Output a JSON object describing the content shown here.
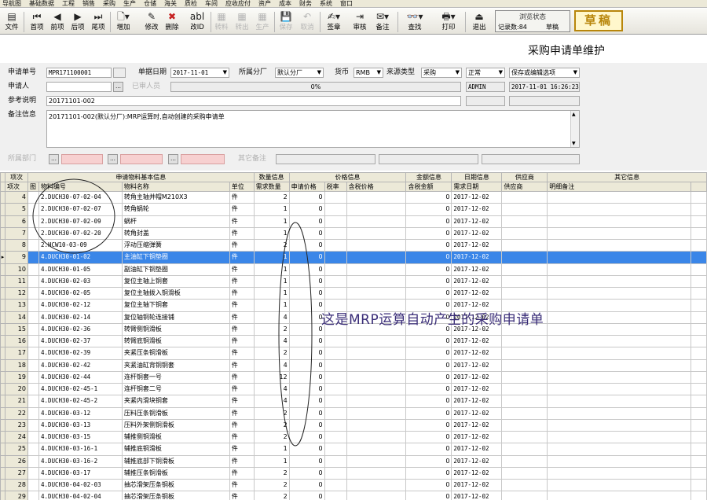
{
  "menu": [
    "导航图",
    "基础数据",
    "工程",
    "销售",
    "采购",
    "生产",
    "仓储",
    "海关",
    "质检",
    "车间",
    "应收应付",
    "资产",
    "成本",
    "财务",
    "系统",
    "窗口"
  ],
  "toolbar": {
    "file": "文件",
    "first": "首项",
    "prev": "前项",
    "next": "后项",
    "last": "尾项",
    "add": "增加",
    "edit": "修改",
    "delete": "删除",
    "change_code": "改ID",
    "batch": "转料",
    "import": "转出",
    "produce": "生产",
    "save": "保存",
    "cancel": "取消",
    "sign": "签章",
    "review": "审核",
    "remark": "备注",
    "find": "查找",
    "print": "打印",
    "exit": "退出"
  },
  "status": {
    "label": "浏览状态",
    "record_count": "记录数:84",
    "state": "草稿"
  },
  "stamp": "草稿",
  "page_title": "采购申请单维护",
  "form": {
    "req_no_label": "申请单号",
    "req_no": "MPR171100001",
    "req_date_label": "单据日期",
    "req_date": "2017-11-01",
    "factory_label": "所属分厂",
    "factory": "默认分厂",
    "currency_label": "货币",
    "currency": "RMB",
    "source_type_label": "来源类型",
    "source_type": "采购",
    "priority": "正常",
    "save_mode": "保存或编辑选项",
    "applicant_label": "申请人",
    "approval_label": "已审人员",
    "progress": "0%",
    "user": "ADMIN",
    "datetime": "2017-11-01 16:26:23",
    "ref_label": "参考说明",
    "ref": "20171101-002",
    "remark_label": "备注信息",
    "remark": "20171101-002(默认分厂):MRP运算时,自动创建的采购申请单",
    "dept_label": "所属部门",
    "other_label": "其它备注"
  },
  "grid": {
    "group_headers": [
      "项次",
      "申请物料基本信息",
      "数量信息",
      "价格信息",
      "金额信息",
      "日期信息",
      "供应商",
      "其它信息"
    ],
    "col_headers": [
      "项次",
      "图",
      "物料编号",
      "物料名称",
      "单位",
      "需求数量",
      "申请价格",
      "税率",
      "含税价格",
      "含税金额",
      "需求日期",
      "供应商",
      "明细备注"
    ],
    "rows": [
      {
        "no": "4",
        "code": "2.DUCH30-07-02-04",
        "name": "转角主轴并帽M210X3",
        "unit": "件",
        "qty": "2",
        "price": "0",
        "amount": "0",
        "date": "2017-12-02"
      },
      {
        "no": "5",
        "code": "2.DUCH30-07-02-07",
        "name": "转角蜗轮",
        "unit": "件",
        "qty": "1",
        "price": "0",
        "amount": "0",
        "date": "2017-12-02"
      },
      {
        "no": "6",
        "code": "2.DUCH30-07-02-09",
        "name": "蜗杆",
        "unit": "件",
        "qty": "1",
        "price": "0",
        "amount": "0",
        "date": "2017-12-02"
      },
      {
        "no": "7",
        "code": "2.DUCH30-07-02-20",
        "name": "转角封盖",
        "unit": "件",
        "qty": "1",
        "price": "0",
        "amount": "0",
        "date": "2017-12-02"
      },
      {
        "no": "8",
        "code": "2.HCW10-03-09",
        "name": "浮动压缩弹簧",
        "unit": "件",
        "qty": "2",
        "price": "0",
        "amount": "0",
        "date": "2017-12-02"
      },
      {
        "no": "9",
        "code": "4.DUCH30-01-02",
        "name": "主油缸下铜垫圈",
        "unit": "件",
        "qty": "1",
        "price": "0",
        "amount": "0",
        "date": "2017-12-02"
      },
      {
        "no": "10",
        "code": "4.DUCH30-01-05",
        "name": "副油缸下铜垫圈",
        "unit": "件",
        "qty": "1",
        "price": "0",
        "amount": "0",
        "date": "2017-12-02"
      },
      {
        "no": "11",
        "code": "4.DUCH30-02-03",
        "name": "复位主轴上铜套",
        "unit": "件",
        "qty": "1",
        "price": "0",
        "amount": "0",
        "date": "2017-12-02"
      },
      {
        "no": "12",
        "code": "4.DUCH30-02-05",
        "name": "复位主轴拨入铜滑板",
        "unit": "件",
        "qty": "1",
        "price": "0",
        "amount": "0",
        "date": "2017-12-02"
      },
      {
        "no": "13",
        "code": "4.DUCH30-02-12",
        "name": "复位主轴下铜套",
        "unit": "件",
        "qty": "1",
        "price": "0",
        "amount": "0",
        "date": "2017-12-02"
      },
      {
        "no": "14",
        "code": "4.DUCH30-02-14",
        "name": "复位轴铜轮连接铺",
        "unit": "件",
        "qty": "4",
        "price": "0",
        "amount": "0",
        "date": "2017-12-02"
      },
      {
        "no": "15",
        "code": "4.DUCH30-02-36",
        "name": "转臂侧铜滑板",
        "unit": "件",
        "qty": "2",
        "price": "0",
        "amount": "0",
        "date": "2017-12-02"
      },
      {
        "no": "16",
        "code": "4.DUCH30-02-37",
        "name": "转臂底铜滑板",
        "unit": "件",
        "qty": "4",
        "price": "0",
        "amount": "0",
        "date": "2017-12-02"
      },
      {
        "no": "17",
        "code": "4.DUCH30-02-39",
        "name": "夹紧压条铜滑板",
        "unit": "件",
        "qty": "2",
        "price": "0",
        "amount": "0",
        "date": "2017-12-02"
      },
      {
        "no": "18",
        "code": "4.DUCH30-02-42",
        "name": "夹紧油缸背铜铜套",
        "unit": "件",
        "qty": "4",
        "price": "0",
        "amount": "0",
        "date": "2017-12-02"
      },
      {
        "no": "19",
        "code": "4.DUCH30-02-44",
        "name": "连杆铜套一号",
        "unit": "件",
        "qty": "12",
        "price": "0",
        "amount": "0",
        "date": "2017-12-02"
      },
      {
        "no": "20",
        "code": "4.DUCH30-02-45-1",
        "name": "连杆铜套二号",
        "unit": "件",
        "qty": "4",
        "price": "0",
        "amount": "0",
        "date": "2017-12-02"
      },
      {
        "no": "21",
        "code": "4.DUCH30-02-45-2",
        "name": "夹紧内滑块铜套",
        "unit": "件",
        "qty": "4",
        "price": "0",
        "amount": "0",
        "date": "2017-12-02"
      },
      {
        "no": "22",
        "code": "4.DUCH30-03-12",
        "name": "压料压条铜滑板",
        "unit": "件",
        "qty": "2",
        "price": "0",
        "amount": "0",
        "date": "2017-12-02"
      },
      {
        "no": "23",
        "code": "4.DUCH30-03-13",
        "name": "压料外架侧铜滑板",
        "unit": "件",
        "qty": "2",
        "price": "0",
        "amount": "0",
        "date": "2017-12-02"
      },
      {
        "no": "24",
        "code": "4.DUCH30-03-15",
        "name": "辅推侧铜滑板",
        "unit": "件",
        "qty": "2",
        "price": "0",
        "amount": "0",
        "date": "2017-12-02"
      },
      {
        "no": "25",
        "code": "4.DUCH30-03-16-1",
        "name": "辅推底铜滑板",
        "unit": "件",
        "qty": "1",
        "price": "0",
        "amount": "0",
        "date": "2017-12-02"
      },
      {
        "no": "26",
        "code": "4.DUCH30-03-16-2",
        "name": "辅推底部下铜滑板",
        "unit": "件",
        "qty": "1",
        "price": "0",
        "amount": "0",
        "date": "2017-12-02"
      },
      {
        "no": "27",
        "code": "4.DUCH30-03-17",
        "name": "辅推压条铜滑板",
        "unit": "件",
        "qty": "2",
        "price": "0",
        "amount": "0",
        "date": "2017-12-02"
      },
      {
        "no": "28",
        "code": "4.DUCH30-04-02-03",
        "name": "抽芯滑架压条铜板",
        "unit": "件",
        "qty": "2",
        "price": "0",
        "amount": "0",
        "date": "2017-12-02"
      },
      {
        "no": "29",
        "code": "4.DUCH30-04-02-04",
        "name": "抽芯滑架压条铜板",
        "unit": "件",
        "qty": "2",
        "price": "0",
        "amount": "0",
        "date": "2017-12-02"
      }
    ],
    "selected_index": 5
  },
  "annotation": "这是MRP运算自动产生的采购申请单",
  "colors": {
    "selection": "#3a86e8",
    "annotation": "#3a2d78",
    "stamp": "#b8860b"
  }
}
